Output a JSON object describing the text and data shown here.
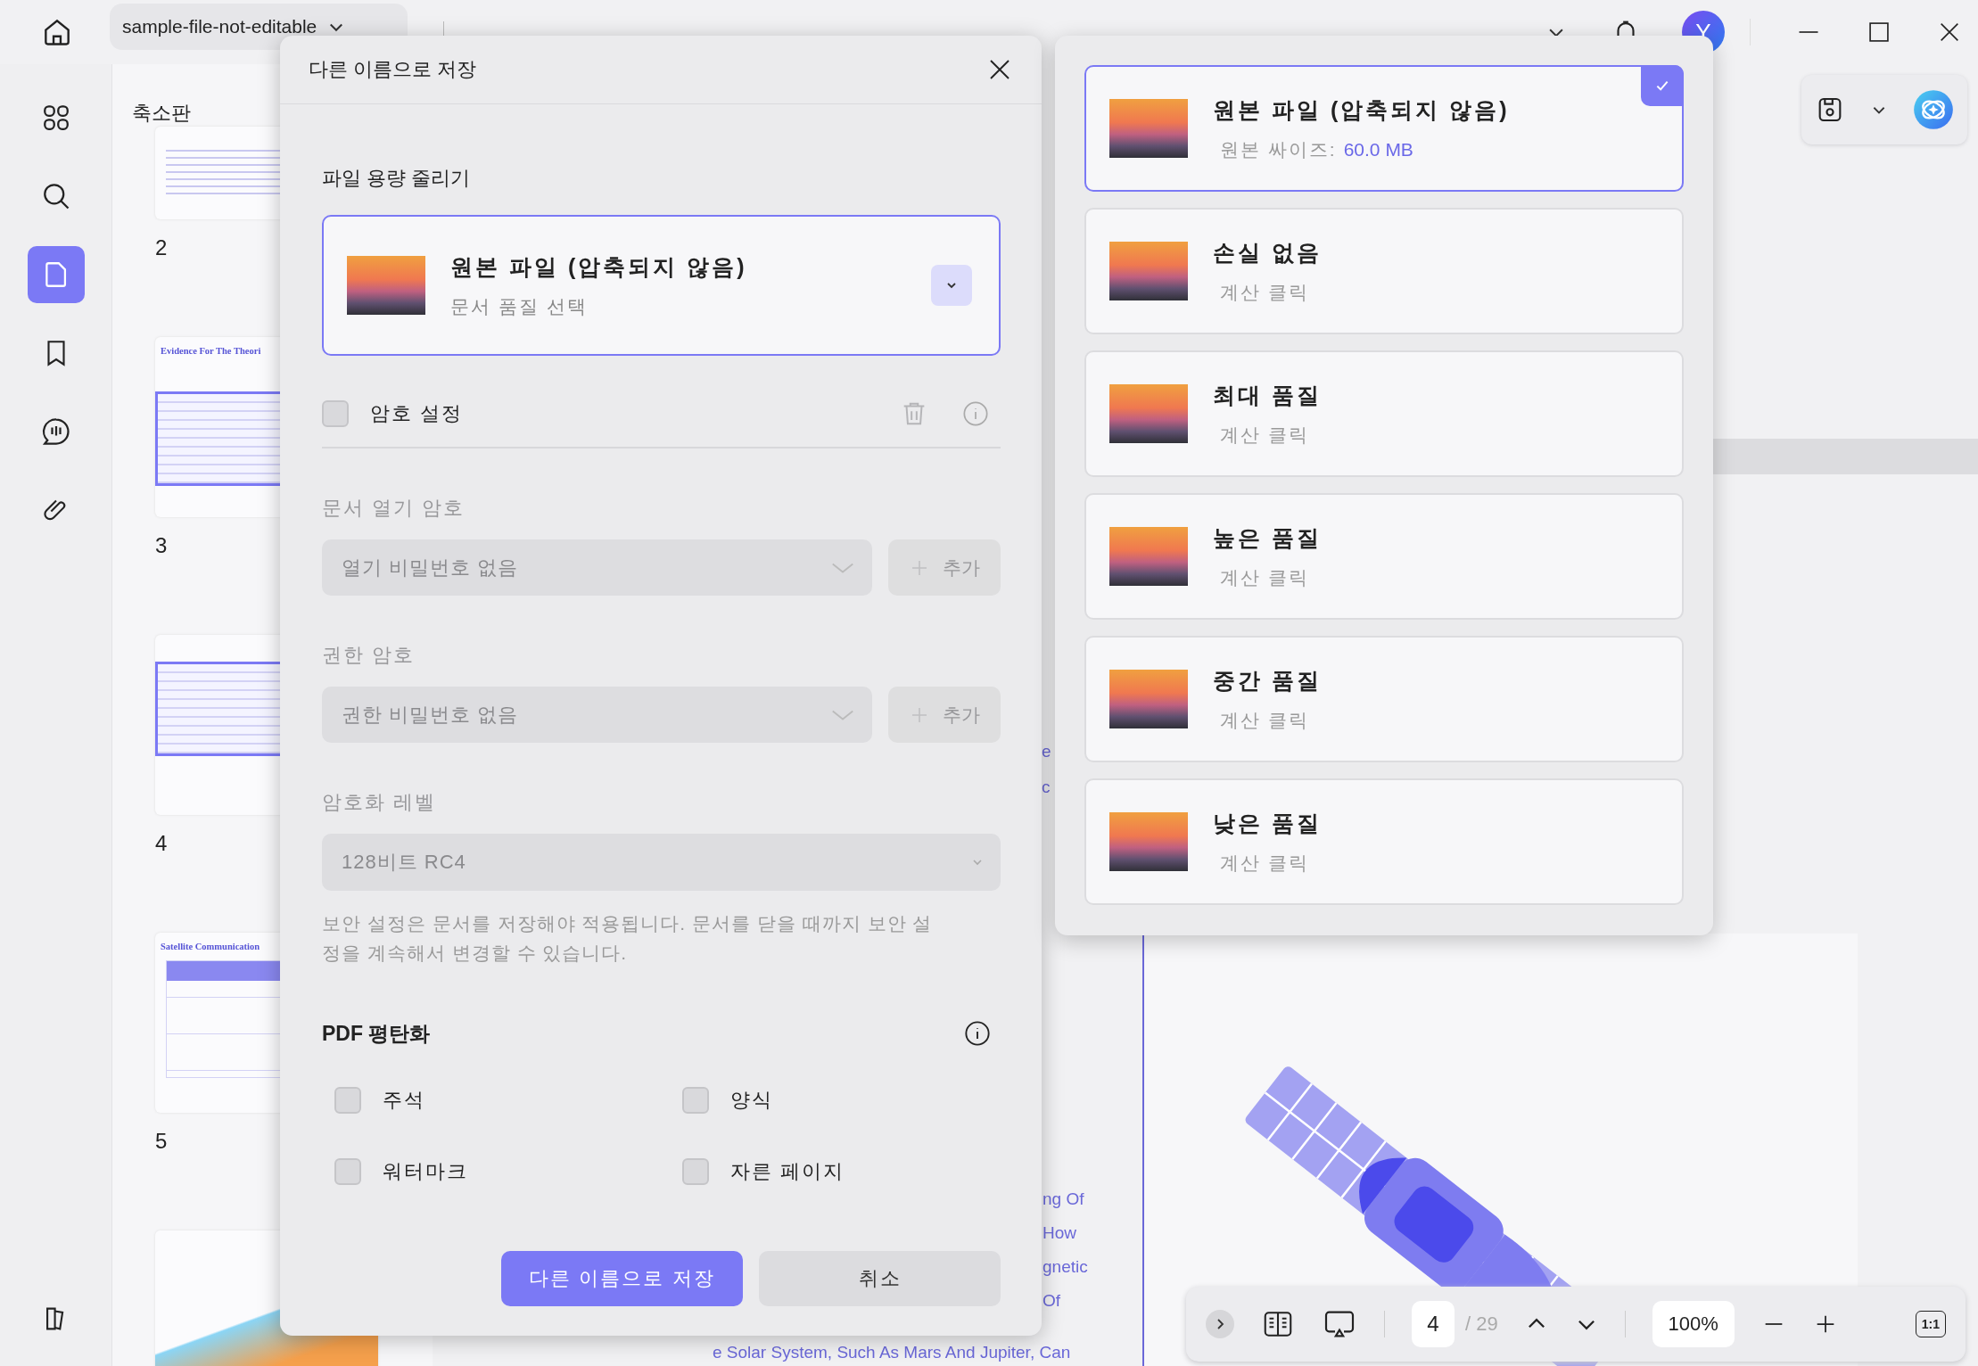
{
  "app_bar": {
    "tab_title": "sample-file-not-editable",
    "avatar_initial": "Y"
  },
  "rail": [
    {
      "kind": "apps",
      "selected": false
    },
    {
      "kind": "search",
      "selected": false
    },
    {
      "kind": "pages",
      "selected": true
    },
    {
      "kind": "bookmark",
      "selected": false
    },
    {
      "kind": "comment",
      "selected": false
    },
    {
      "kind": "attachment",
      "selected": false
    }
  ],
  "thumbnail_panel": {
    "title": "축소판",
    "pages": [
      {
        "number": "2",
        "kind": "text"
      },
      {
        "number": "3",
        "kind": "diagram",
        "heading": "Evidence For The Theori"
      },
      {
        "number": "4",
        "kind": "diagram"
      },
      {
        "number": "5",
        "kind": "table",
        "heading": "Satellite Communication"
      },
      {
        "kind": "script"
      }
    ]
  },
  "document_fragments": [
    "e",
    "c",
    "ng Of",
    "How",
    "gnetic",
    "Of",
    "e Solar System, Such As Mars And Jupiter, Can"
  ],
  "dialog": {
    "title": "다른 이름으로 저장",
    "reduce_heading": "파일 용량 줄리기",
    "quality_select": {
      "title": "원본 파일 (압축되지 않음)",
      "subtitle": "문서 품질 선택"
    },
    "password_checkbox": {
      "label": "암호 설정",
      "checked": false
    },
    "open_password": {
      "label": "문서 열기 암호",
      "value": "열기 비밀번호 없음",
      "add": "추가",
      "disabled": true
    },
    "permission_password": {
      "label": "권한 암호",
      "value": "권한 비밀번호 없음",
      "add": "추가",
      "disabled": true
    },
    "encryption": {
      "label": "암호화 레벨",
      "value": "128비트 RC4",
      "disabled": true
    },
    "notice": "보안 설정은 문서를 저장해야 적용됩니다. 문서를 닫을 때까지 보안 설정을 계속해서 변경할 수 있습니다.",
    "flatten_heading": "PDF 평탄화",
    "flatten_options": [
      {
        "label": "주석",
        "checked": false
      },
      {
        "label": "양식",
        "checked": false
      },
      {
        "label": "워터마크",
        "checked": false
      },
      {
        "label": "자른 페이지",
        "checked": false
      }
    ],
    "buttons": [
      {
        "label": "다른 이름으로 저장",
        "kind": "primary"
      },
      {
        "label": "취소",
        "kind": "secondary"
      }
    ]
  },
  "quality_options": [
    {
      "title": "원본 파일 (압축되지 않음)",
      "subtitle": "원본 싸이즈:",
      "value": "60.0 MB",
      "selected": true
    },
    {
      "title": "손실 없음",
      "subtitle": "계산 클릭",
      "selected": false
    },
    {
      "title": "최대 품질",
      "subtitle": "계산 클릭",
      "selected": false
    },
    {
      "title": "높은 품질",
      "subtitle": "계산 클릭",
      "selected": false
    },
    {
      "title": "중간 품질",
      "subtitle": "계산 클릭",
      "selected": false
    },
    {
      "title": "낮은 품질",
      "subtitle": "계산 클릭",
      "selected": false
    }
  ],
  "bottom_toolbar": {
    "page": "4",
    "total": "/ 29",
    "zoom": "100%",
    "actual_size": "1:1"
  }
}
